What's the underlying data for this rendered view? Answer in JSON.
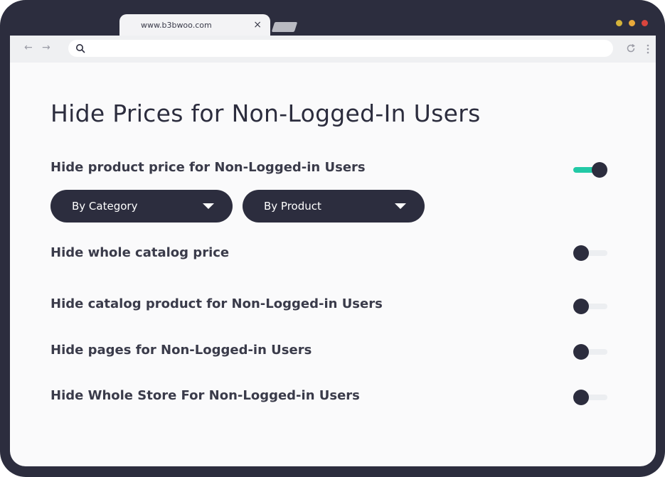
{
  "browser": {
    "tab_title": "www.b3bwoo.com",
    "tab_close": "×",
    "back_glyph": "←",
    "forward_glyph": "→",
    "window_dots": [
      "#d4b33a",
      "#e8a93a",
      "#d9453d"
    ]
  },
  "page": {
    "title": "Hide Prices for Non-Logged-In Users",
    "settings": [
      {
        "label": "Hide product price for Non-Logged-in Users",
        "enabled": true
      },
      {
        "label": "Hide whole catalog price",
        "enabled": false
      },
      {
        "label": "Hide catalog product for Non-Logged-in Users",
        "enabled": false
      },
      {
        "label": "Hide pages for Non-Logged-in Users",
        "enabled": false
      },
      {
        "label": "Hide Whole Store For Non-Logged-in Users",
        "enabled": false
      }
    ],
    "dropdowns": [
      {
        "label": "By Category"
      },
      {
        "label": "By Product"
      }
    ]
  },
  "colors": {
    "accent": "#22c9a6",
    "dark": "#2c2d3e"
  }
}
